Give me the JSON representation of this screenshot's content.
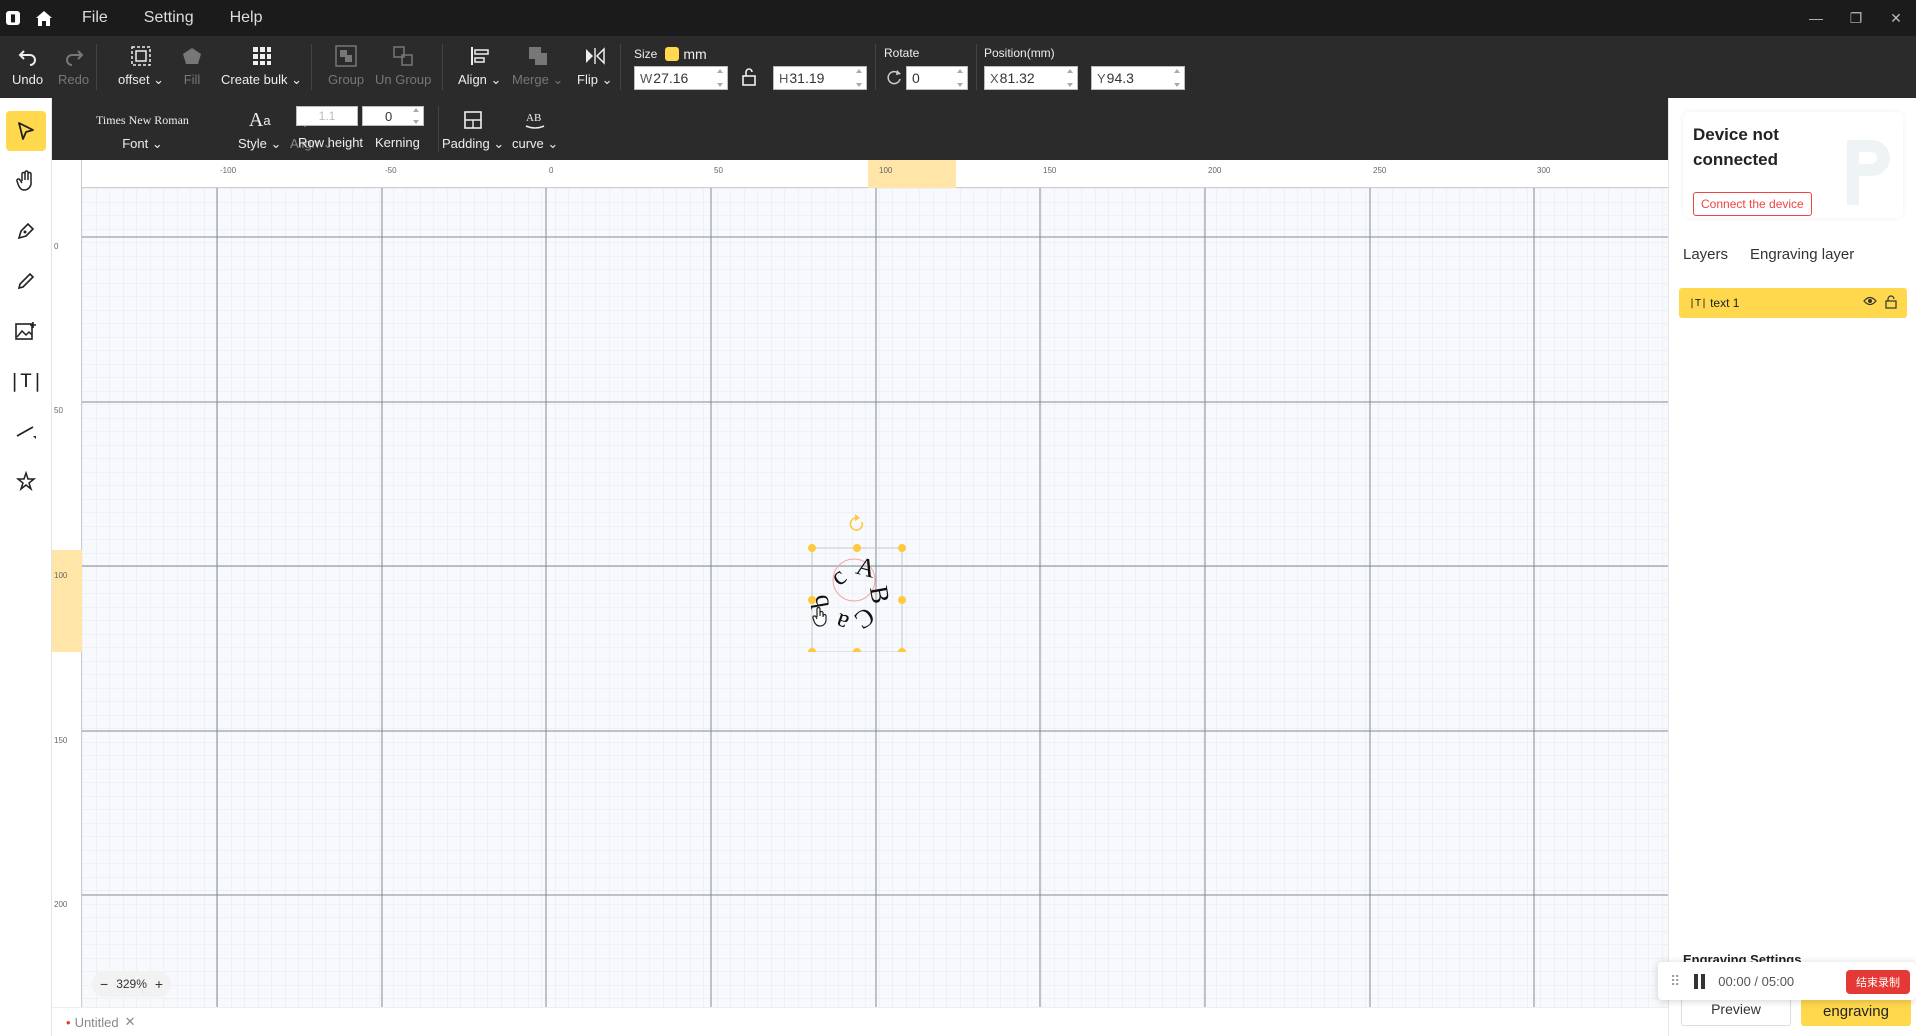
{
  "menu": [
    "File",
    "Setting",
    "Help"
  ],
  "toolbar": {
    "undo": "Undo",
    "redo": "Redo",
    "offset": "offset",
    "fill": "Fill",
    "create_bulk": "Create bulk",
    "group": "Group",
    "ungroup": "Un Group",
    "align": "Align",
    "merge": "Merge",
    "flip": "Flip",
    "size_label": "Size",
    "unit": "mm",
    "w_prefix": "W",
    "w_value": "27.16",
    "h_prefix": "H",
    "h_value": "31.19",
    "rotate_label": "Rotate",
    "rotate_value": "0",
    "position_label": "Position(mm)",
    "x_prefix": "X",
    "x_value": "81.32",
    "y_prefix": "Y",
    "y_value": "94.3"
  },
  "text_toolbar": {
    "font_name": "Times New Roman",
    "font_label": "Font",
    "style_label": "Style",
    "align_label": "Align",
    "row_height_value": "1.1",
    "row_height_label": "Row height",
    "kerning_value": "0",
    "kerning_label": "Kerning",
    "padding_label": "Padding",
    "curve_label": "curve"
  },
  "left_tools": [
    "select-tool",
    "hand-tool",
    "pen-tool",
    "pencil-tool",
    "image-tool",
    "text-tool",
    "line-tool",
    "magic-tool"
  ],
  "canvas": {
    "hruler_labels": [
      "-100",
      "-50",
      "0",
      "50",
      "100",
      "150",
      "200",
      "250",
      "300"
    ],
    "vruler_labels": [
      "0",
      "50",
      "100",
      "150",
      "200"
    ],
    "letters": [
      "A",
      "B",
      "C",
      "a",
      "b",
      "c"
    ],
    "zoom": "329%",
    "tab_name": "Untitled"
  },
  "right_panel": {
    "device_status": "Device not connected",
    "connect_button": "Connect the device",
    "tabs": [
      "Layers",
      "Engraving layer"
    ],
    "layer_icon": "|T|",
    "layer_name": "text 1",
    "engraving_settings": "Engraving Settings",
    "preview": "Preview",
    "engraving": "engraving"
  },
  "recorder": {
    "time": "00:00 / 05:00",
    "stop_label": "结束录制"
  },
  "colors": {
    "accent": "#ffd84d",
    "dark_toolbar": "#2b2b2b",
    "titlebar": "#1b1b1b",
    "danger": "#e53935"
  }
}
